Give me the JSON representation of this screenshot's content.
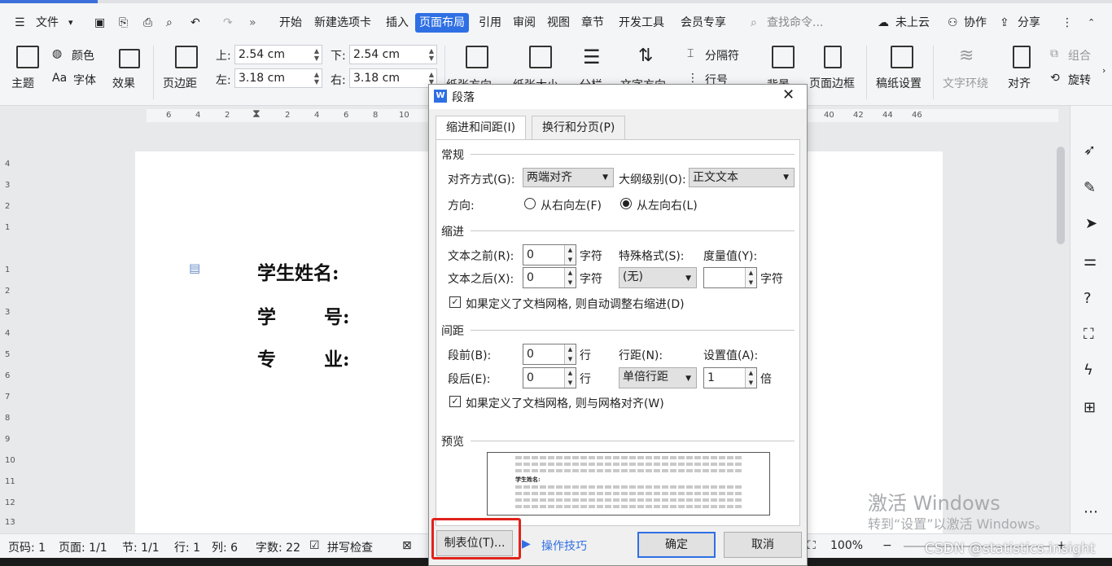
{
  "menubar": {
    "file": "文件",
    "tabs": [
      "开始",
      "新建选项卡",
      "插入",
      "页面布局",
      "引用",
      "审阅",
      "视图",
      "章节",
      "开发工具",
      "会员专享"
    ],
    "active_tab": "页面布局",
    "search_placeholder": "查找命令...",
    "cloud": "未上云",
    "collab": "协作",
    "share": "分享"
  },
  "ribbon": {
    "theme": "主题",
    "color": "颜色",
    "font": "字体",
    "effect": "效果",
    "margins": "页边距",
    "top_label": "上:",
    "top_value": "2.54 cm",
    "bottom_label": "下:",
    "bottom_value": "2.54 cm",
    "left_label": "左:",
    "left_value": "3.18 cm",
    "right_label": "右:",
    "right_value": "3.18 cm",
    "orientation": "纸张方向",
    "size": "纸张大小",
    "columns": "分栏",
    "text_dir": "文字方向",
    "breaks": "分隔符",
    "line_num": "行号",
    "background": "背景",
    "border": "页面边框",
    "grid_paper": "稿纸设置",
    "wrap": "文字环绕",
    "align": "对齐",
    "group": "组合",
    "rotate": "旋转"
  },
  "ruler": {
    "h_ticks": [
      "6",
      "4",
      "2",
      "2",
      "4",
      "6",
      "8",
      "10",
      "40",
      "42",
      "44",
      "46"
    ],
    "v_ticks": [
      "4",
      "3",
      "2",
      "1",
      "1",
      "2",
      "3",
      "4",
      "5",
      "6",
      "7",
      "8",
      "9",
      "10",
      "11",
      "12",
      "13"
    ]
  },
  "document": {
    "line1": "学生姓名:",
    "line2_a": "学",
    "line2_b": "号:",
    "line3_a": "专",
    "line3_b": "业:"
  },
  "dialog": {
    "title": "段落",
    "tab1": "缩进和间距(I)",
    "tab2": "换行和分页(P)",
    "general": "常规",
    "align_label": "对齐方式(G):",
    "align_value": "两端对齐",
    "outline_label": "大纲级别(O):",
    "outline_value": "正文文本",
    "direction_label": "方向:",
    "rtl": "从右向左(F)",
    "ltr": "从左向右(L)",
    "indent": "缩进",
    "before_text_label": "文本之前(R):",
    "before_text_value": "0",
    "after_text_label": "文本之后(X):",
    "after_text_value": "0",
    "char_unit": "字符",
    "special_label": "特殊格式(S):",
    "special_value": "(无)",
    "measure_label": "度量值(Y):",
    "measure_value": "",
    "auto_indent": "如果定义了文档网格, 则自动调整右缩进(D)",
    "spacing": "间距",
    "before_label": "段前(B):",
    "before_value": "0",
    "after_label": "段后(E):",
    "after_value": "0",
    "line_unit": "行",
    "linespace_label": "行距(N):",
    "linespace_value": "单倍行距",
    "setvalue_label": "设置值(A):",
    "setvalue_value": "1",
    "times_unit": "倍",
    "snap_grid": "如果定义了文档网格, 则与网格对齐(W)",
    "preview": "预览",
    "preview_sample": "学生姓名:",
    "tabs_button": "制表位(T)...",
    "tips": "操作技巧",
    "ok": "确定",
    "cancel": "取消"
  },
  "status": {
    "page_num": "页码: 1",
    "pages": "页面: 1/1",
    "section": "节: 1/1",
    "row": "行: 1",
    "col": "列: 6",
    "words": "字数: 22",
    "spell": "拼写检查",
    "zoom": "100%"
  },
  "watermark": {
    "line1": "激活 Windows",
    "line2": "转到“设置”以激活 Windows。",
    "csdn": "CSDN @statistics.insight"
  },
  "colors": {
    "accent": "#2f6fe4",
    "highlight": "#e0221d"
  }
}
